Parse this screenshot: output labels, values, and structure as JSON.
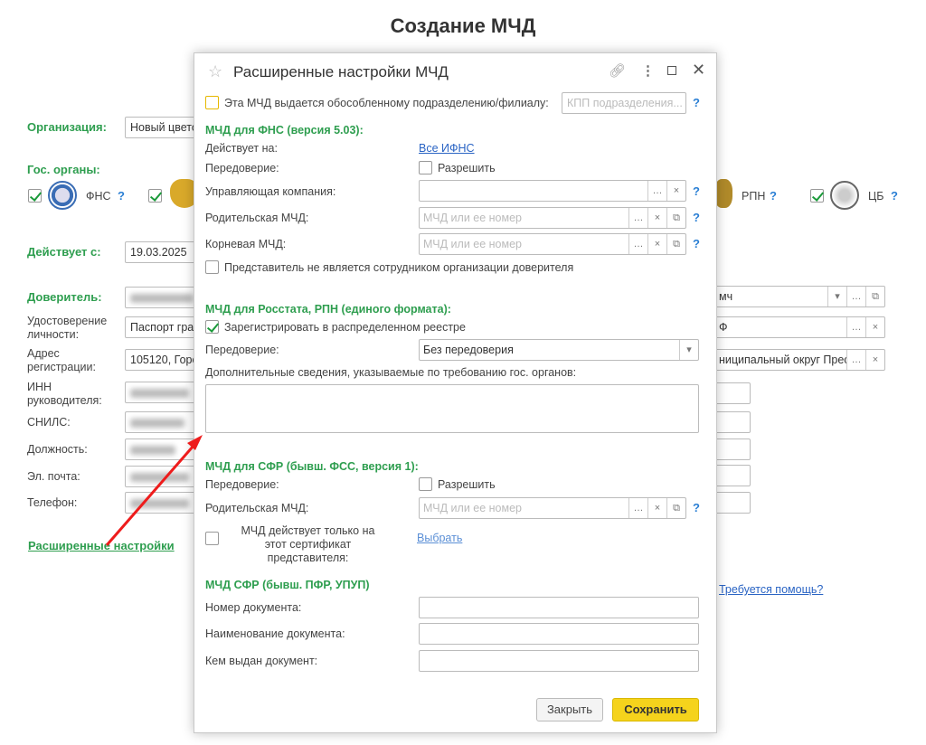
{
  "page": {
    "title": "Создание МЧД",
    "org_label": "Организация:",
    "org_value": "Новый цвето",
    "gov_label": "Гос. органы:",
    "gov_items": [
      {
        "label": "ФНС",
        "checked": true
      },
      {
        "label": "",
        "checked": true
      },
      {
        "label": "РПН",
        "checked": true
      },
      {
        "label": "ЦБ",
        "checked": true
      }
    ],
    "help": "?",
    "valid_from_label": "Действует с:",
    "valid_from_value": "19.03.2025",
    "principal_label": "Доверитель:",
    "principal_tail": "мч",
    "id_doc_label": "Удостоверение личности:",
    "id_doc_value": "Паспорт гра",
    "id_doc_tail": "Ф",
    "address_label": "Адрес регистрации:",
    "address_value": "105120, Горо",
    "address_tail": "ниципальный округ Пресі",
    "inn_label": "ИНН руководителя:",
    "snils_label": "СНИЛС:",
    "position_label": "Должность:",
    "email_label": "Эл. почта:",
    "phone_label": "Телефон:",
    "advanced_link": "Расширенные настройки",
    "help_link": "Требуется помощь?"
  },
  "dialog": {
    "title": "Расширенные настройки МЧД",
    "branch_checkbox": "Эта МЧД выдается обособленному подразделению/филиалу:",
    "kpp_placeholder": "КПП подразделения...",
    "fns": {
      "header": "МЧД для ФНС (версия 5.03):",
      "acts_on_label": "Действует на:",
      "acts_on_link": "Все ИФНС",
      "redelegation_label": "Передоверие:",
      "allow": "Разрешить",
      "mgmt_label": "Управляющая компания:",
      "parent_label": "Родительская МЧД:",
      "root_label": "Корневая МЧД:",
      "mchd_placeholder": "МЧД или ее номер",
      "not_employee": "Представитель не является сотрудником организации доверителя"
    },
    "rosstat": {
      "header": "МЧД для Росстата, РПН (единого формата):",
      "register": "Зарегистрировать в распределенном реестре",
      "register_checked": true,
      "redelegation_label": "Передоверие:",
      "redelegation_value": "Без передоверия",
      "extra_label": "Дополнительные сведения, указываемые по требованию гос. органов:"
    },
    "sfr": {
      "header": "МЧД для СФР (бывш. ФСС, версия 1):",
      "redelegation_label": "Передоверие:",
      "allow": "Разрешить",
      "parent_label": "Родительская МЧД:",
      "mchd_placeholder": "МЧД или ее номер",
      "cert_only": "МЧД действует только на этот сертификат представителя:",
      "choose": "Выбрать"
    },
    "pfr": {
      "header": "МЧД СФР (бывш. ПФР, УПУП)",
      "doc_number": "Номер документа:",
      "doc_name": "Наименование документа:",
      "issued_by": "Кем выдан документ:"
    },
    "close": "Закрыть",
    "save": "Сохранить",
    "accent": "#f5d31c"
  }
}
